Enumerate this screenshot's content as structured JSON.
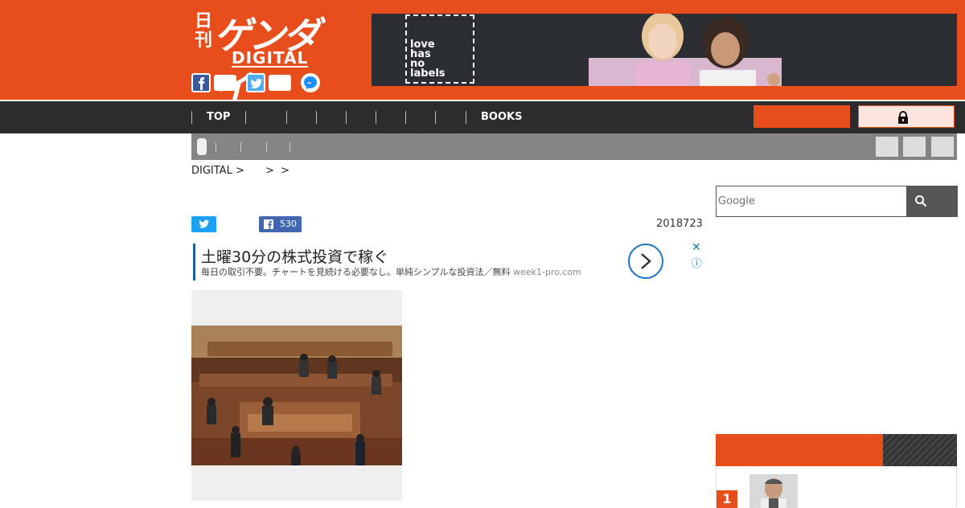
{
  "header": {
    "logo": {
      "kanji_small": "日刊",
      "kanji_big": "ゲンダイ",
      "sub": "DIGITAL"
    },
    "share": {
      "icons": [
        "facebook-icon",
        "twitter-icon",
        "messenger-icon"
      ]
    },
    "ad_banner": {
      "lines": [
        "love",
        "has",
        "no",
        "labels"
      ]
    }
  },
  "nav": {
    "items": [
      "TOP",
      "",
      "",
      "",
      "",
      "",
      "",
      "",
      "BOOKS"
    ],
    "login_icon": "lock-icon"
  },
  "breadcrumb": {
    "items": [
      "DIGITAL >",
      ">",
      ">"
    ]
  },
  "article": {
    "fb_count": "530",
    "date": "2018723"
  },
  "text_ad": {
    "title": "土曜30分の株式投資で稼ぐ",
    "description": "毎日の取引不要。チャートを見続ける必要なし。単純シンプルな投資法／無料",
    "domain": "week1-pro.com",
    "close": "✕",
    "info": "ⓘ"
  },
  "sidebar": {
    "search_placeholder": "Google",
    "ranking_first_num": "1"
  },
  "colors": {
    "brand": "#e84e1b",
    "nav": "#2c2c2c",
    "subbar": "#848484"
  }
}
